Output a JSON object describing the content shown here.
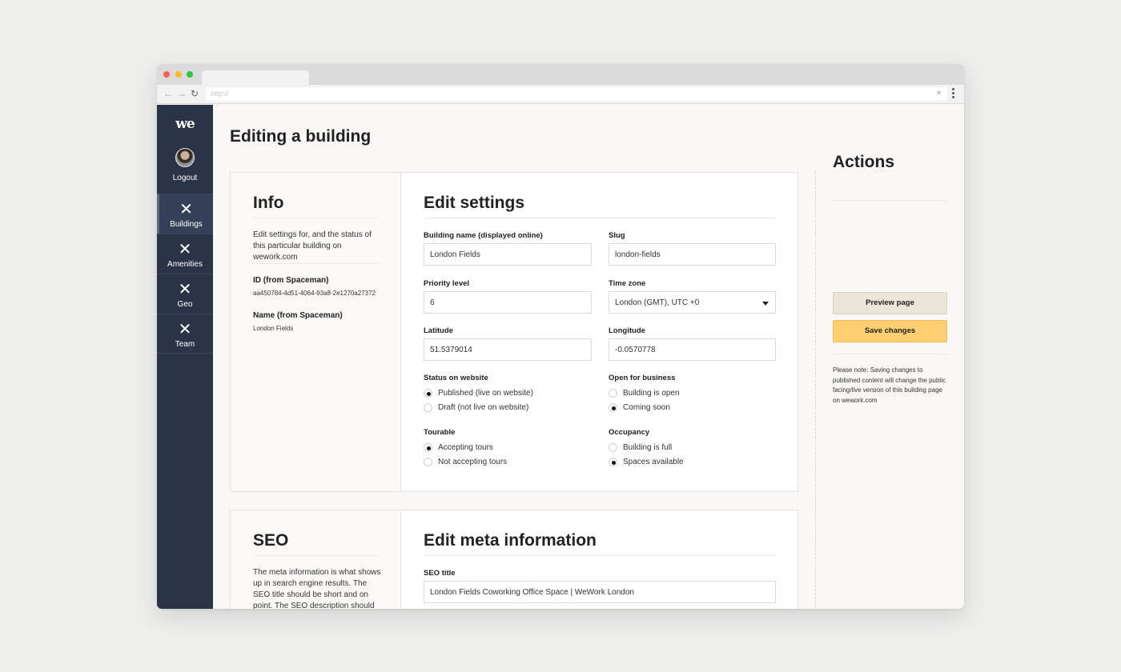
{
  "browser": {
    "url_placeholder": "http://"
  },
  "sidebar": {
    "logo": "we",
    "logout": "Logout",
    "items": [
      {
        "label": "Buildings",
        "icon": "close-icon",
        "active": true
      },
      {
        "label": "Amenities",
        "icon": "close-icon",
        "active": false
      },
      {
        "label": "Geo",
        "icon": "close-icon",
        "active": false
      },
      {
        "label": "Team",
        "icon": "close-icon",
        "active": false
      }
    ]
  },
  "page": {
    "title": "Editing a building"
  },
  "info": {
    "heading": "Info",
    "description": "Edit settings for, and the status of this particular building on wework.com",
    "id_label": "ID (from Spaceman)",
    "id_value": "aa450784-4d51-4064-93a8-2e1270a27372",
    "name_label": "Name (from Spaceman)",
    "name_value": "London Fields"
  },
  "settings": {
    "heading": "Edit settings",
    "building_name": {
      "label": "Building name (displayed online)",
      "value": "London Fields"
    },
    "slug": {
      "label": "Slug",
      "value": "london-fields"
    },
    "priority": {
      "label": "Priority level",
      "value": "6"
    },
    "timezone": {
      "label": "Time zone",
      "value": "London (GMT), UTC +0"
    },
    "latitude": {
      "label": "Latitude",
      "value": "51.5379014"
    },
    "longitude": {
      "label": "Longitude",
      "value": "-0.0570778"
    },
    "status": {
      "label": "Status on website",
      "options": [
        "Published (live on website)",
        "Draft (not live on website)"
      ],
      "selected": 0
    },
    "open": {
      "label": "Open for business",
      "options": [
        "Building is open",
        "Coming soon"
      ],
      "selected": 1
    },
    "tourable": {
      "label": "Tourable",
      "options": [
        "Accepting tours",
        "Not accepting tours"
      ],
      "selected": 0
    },
    "occupancy": {
      "label": "Occupancy",
      "options": [
        "Building is full",
        "Spaces available"
      ],
      "selected": 1
    }
  },
  "seo": {
    "heading": "SEO",
    "description": "The meta information is what shows up in search engine results. The SEO title should be short and on point. The SEO description should be no more",
    "meta_heading": "Edit meta information",
    "title_label": "SEO title",
    "title_value": "London Fields Coworking Office Space | WeWork London"
  },
  "actions": {
    "heading": "Actions",
    "preview_label": "Preview page",
    "save_label": "Save changes",
    "note": "Please note: Saving changes to published content will change the public facing/live version of this building page on wework.com"
  },
  "colors": {
    "sidebar": "#2b3446",
    "save_button": "#fecf70",
    "preview_button": "#ebe7d8"
  }
}
